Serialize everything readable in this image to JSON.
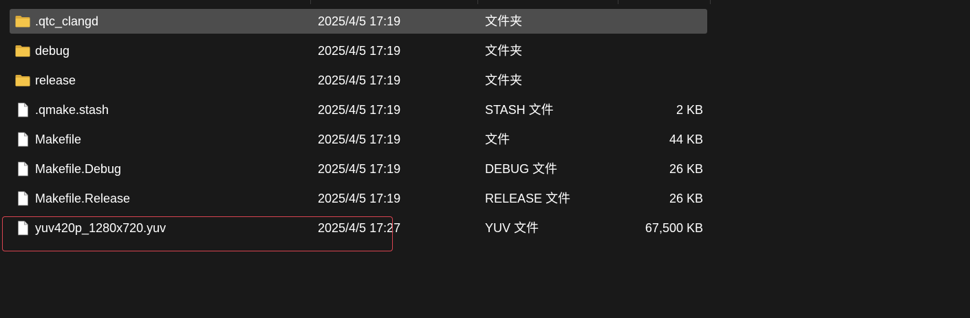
{
  "files": [
    {
      "name": ".qtc_clangd",
      "date": "2025/4/5 17:19",
      "type": "文件夹",
      "size": "",
      "icon": "folder-icon",
      "selected": true
    },
    {
      "name": "debug",
      "date": "2025/4/5 17:19",
      "type": "文件夹",
      "size": "",
      "icon": "folder-icon",
      "selected": false
    },
    {
      "name": "release",
      "date": "2025/4/5 17:19",
      "type": "文件夹",
      "size": "",
      "icon": "folder-icon",
      "selected": false
    },
    {
      "name": ".qmake.stash",
      "date": "2025/4/5 17:19",
      "type": "STASH 文件",
      "size": "2 KB",
      "icon": "file-icon",
      "selected": false
    },
    {
      "name": "Makefile",
      "date": "2025/4/5 17:19",
      "type": "文件",
      "size": "44 KB",
      "icon": "file-icon",
      "selected": false
    },
    {
      "name": "Makefile.Debug",
      "date": "2025/4/5 17:19",
      "type": "DEBUG 文件",
      "size": "26 KB",
      "icon": "file-icon",
      "selected": false
    },
    {
      "name": "Makefile.Release",
      "date": "2025/4/5 17:19",
      "type": "RELEASE 文件",
      "size": "26 KB",
      "icon": "file-icon",
      "selected": false
    },
    {
      "name": "yuv420p_1280x720.yuv",
      "date": "2025/4/5 17:27",
      "type": "YUV 文件",
      "size": "67,500 KB",
      "icon": "file-icon",
      "selected": false
    }
  ],
  "colors": {
    "background": "#191919",
    "selected_row": "#4d4d4d",
    "highlight_border": "#d94450",
    "folder": "#f4c54a"
  }
}
